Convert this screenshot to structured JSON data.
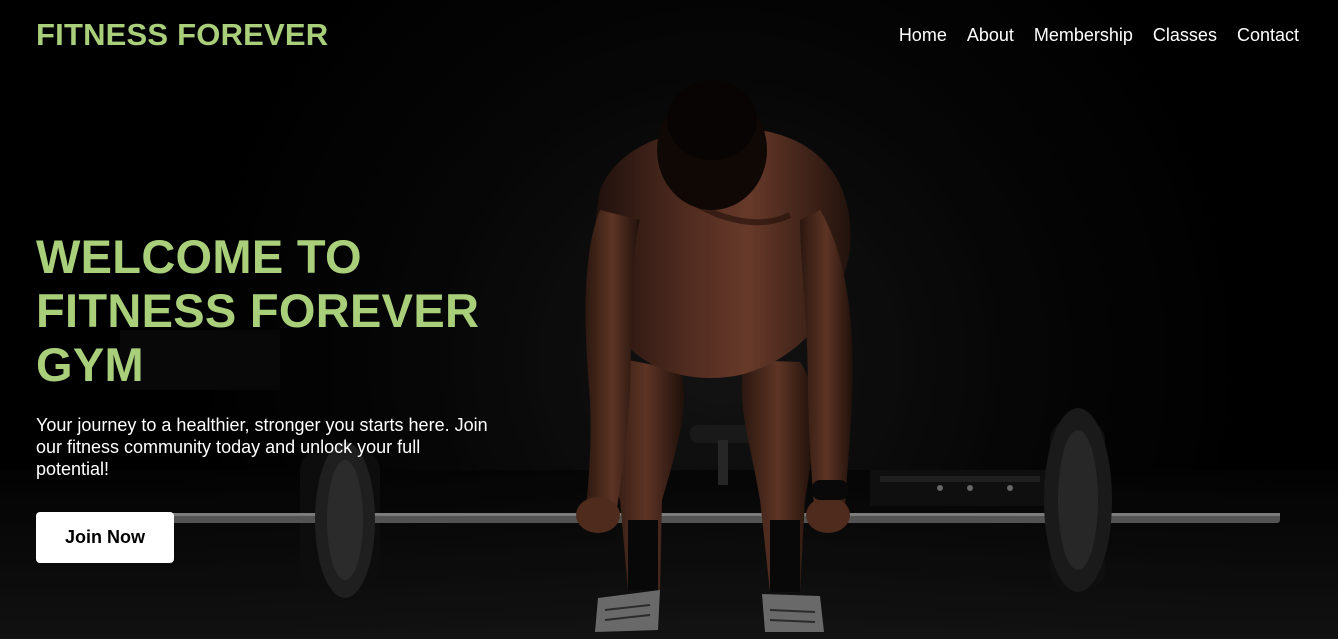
{
  "navbar": {
    "brand": "FITNESS FOREVER",
    "links": [
      "Home",
      "About",
      "Membership",
      "Classes",
      "Contact"
    ]
  },
  "hero": {
    "title": "WELCOME TO FITNESS FOREVER GYM",
    "text": "Your journey to a healthier, stronger you starts here. Join our fitness community today and unlock your full potential!",
    "cta_label": "Join Now",
    "background_image": "man-deadlifting-barbell-photo"
  },
  "colors": {
    "accent": "#a9cf7a",
    "background": "#000000",
    "button_bg": "#ffffff",
    "button_text": "#000000",
    "nav_text": "#ffffff"
  }
}
